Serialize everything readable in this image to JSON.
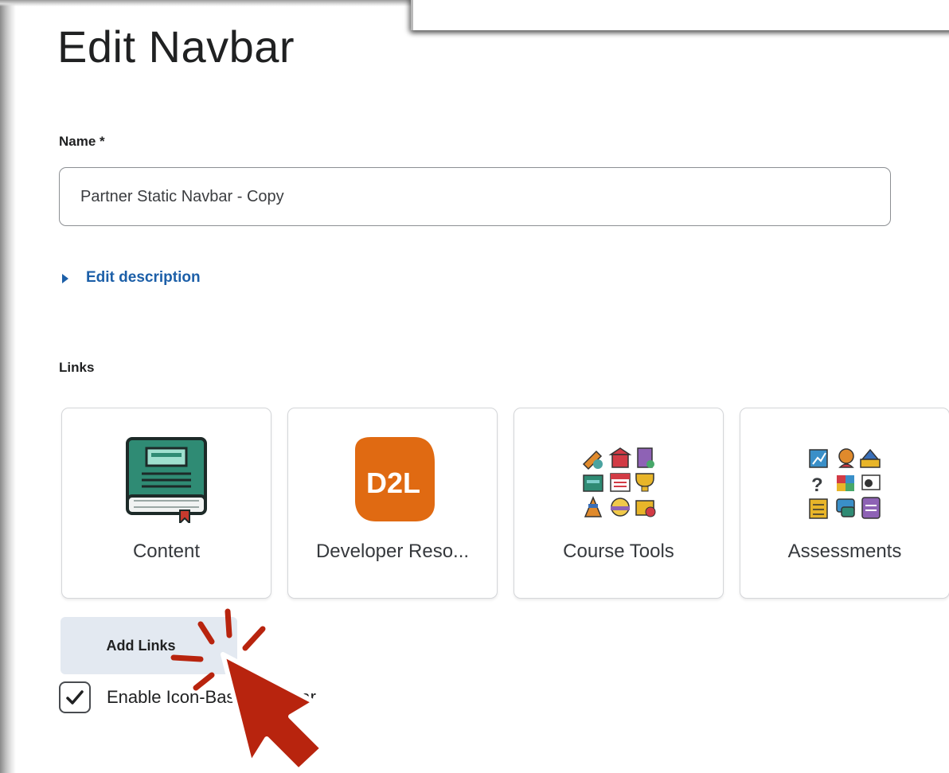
{
  "title": "Edit Navbar",
  "name_field": {
    "label": "Name *",
    "value": "Partner Static Navbar - Copy"
  },
  "edit_description": {
    "label": "Edit description"
  },
  "links": {
    "label": "Links",
    "tiles": [
      {
        "label": "Content",
        "icon": "book-icon"
      },
      {
        "label": "Developer Reso...",
        "icon": "d2l-logo-icon",
        "logo_text": "D2L"
      },
      {
        "label": "Course Tools",
        "icon": "tools-grid-icon"
      },
      {
        "label": "Assessments",
        "icon": "assessments-grid-icon"
      }
    ]
  },
  "add_links_button": {
    "label": "Add Links"
  },
  "enable_icon_navbar": {
    "label": "Enable Icon-Based Navbar",
    "checked": true
  },
  "colors": {
    "link_blue": "#1c5fa8",
    "button_bg": "#e3e9f1",
    "d2l_orange": "#e06a12",
    "book_green": "#2f8b74",
    "cursor_red": "#b8240e"
  }
}
